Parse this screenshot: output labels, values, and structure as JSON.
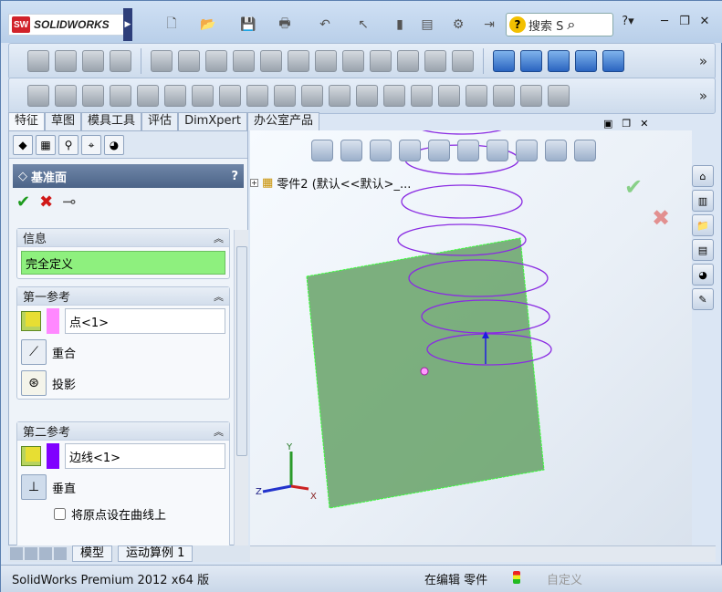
{
  "app": {
    "brand": "SOLIDWORKS",
    "brand_mark": "SW"
  },
  "search": {
    "placeholder": "搜索 S",
    "help": "?"
  },
  "cmd_tabs": [
    {
      "label": "特征"
    },
    {
      "label": "草图"
    },
    {
      "label": "模具工具"
    },
    {
      "label": "评估"
    },
    {
      "label": "DimXpert"
    },
    {
      "label": "办公室产品"
    }
  ],
  "property_manager": {
    "title": "基准面",
    "help": "?",
    "info": {
      "header": "信息",
      "message": "完全定义"
    },
    "first_ref": {
      "header": "第一参考",
      "value": "点<1>",
      "swatch": "#ff88ff",
      "opt1": "重合",
      "opt2": "投影"
    },
    "second_ref": {
      "header": "第二参考",
      "value": "边线<1>",
      "swatch": "#8000ff",
      "opt1": "垂直",
      "checkbox": "将原点设在曲线上"
    }
  },
  "tree": {
    "root": "零件2  (默认<<默认>_..."
  },
  "bottom_tabs": [
    {
      "label": "模型"
    },
    {
      "label": "运动算例 1"
    }
  ],
  "status": {
    "product": "SolidWorks Premium 2012 x64 版",
    "mode": "在编辑 零件",
    "custom": "自定义"
  },
  "colors": {
    "plane": "#5f9e5f",
    "helix": "#8a2be2"
  }
}
